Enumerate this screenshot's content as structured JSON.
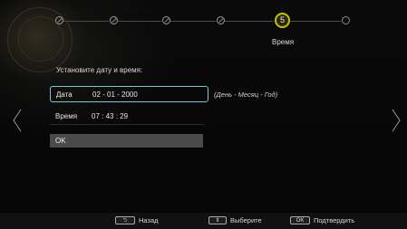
{
  "wizard": {
    "steps": [
      {
        "state": "done"
      },
      {
        "state": "done"
      },
      {
        "state": "done"
      },
      {
        "state": "done"
      },
      {
        "state": "active",
        "number": "5",
        "label": "Время"
      },
      {
        "state": "pending"
      }
    ]
  },
  "form": {
    "prompt": "Установите дату и время:",
    "date_label": "Дата",
    "date_value": "02 - 01 - 2000",
    "date_hint": "(День - Месяц - Год)",
    "time_label": "Время",
    "time_value": "07 : 43 : 29",
    "ok_label": "OK"
  },
  "footer": {
    "back_key": "⮌",
    "back_label": "Назад",
    "select_key": "⇕",
    "select_label": "Выберите",
    "confirm_key": "OK",
    "confirm_label": "Подтвердить"
  },
  "colors": {
    "accent_active_step": "#c9c100",
    "focus_border": "#7cc4d8",
    "button_bg": "#4a4a4a"
  }
}
